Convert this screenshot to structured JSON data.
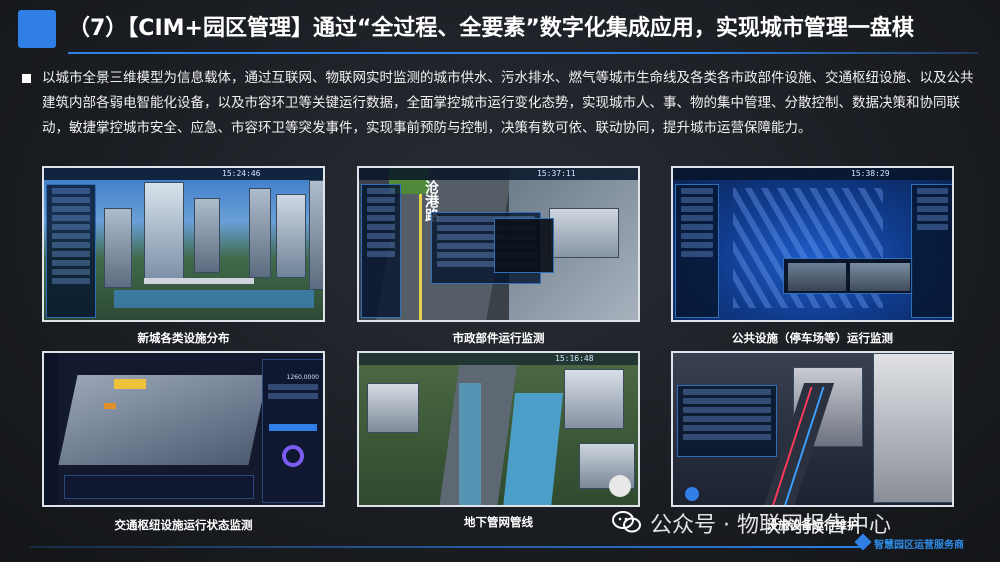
{
  "slide": {
    "title": "（7）【CIM+园区管理】通过“全过程、全要素”数字化集成应用，实现城市管理一盘棋",
    "paragraph": "以城市全景三维模型为信息载体，通过互联网、物联网实时监测的城市供水、污水排水、燃气等城市生命线及各类各市政部件设施、交通枢纽设施、以及公共建筑内部各弱电智能化设备，以及市容环卫等关键运行数据，全面掌控城市运行变化态势，实现城市人、事、物的集中管理、分散控制、数据决策和协同联动，敏捷掌控城市安全、应急、市容环卫等突发事件，实现事前预防与控制，决策有数可依、联动协同，提升城市运营保障能力。"
  },
  "screenshots": [
    {
      "caption": "新城各类设施分布",
      "time": "15:24:46"
    },
    {
      "caption": "市政部件运行监测",
      "time": "15:37:11",
      "road_text": "沧港路"
    },
    {
      "caption": "公共设施（停车场等）运行监测",
      "time": "15:38:29"
    },
    {
      "caption": "交通枢纽设施运行状态监测",
      "stat": "1260,0000"
    },
    {
      "caption": "地下管网管线",
      "time": "15:16:48"
    },
    {
      "caption": "设施设备运行维护"
    }
  ],
  "footer": {
    "watermark": "公众号 · 物联网报告中心",
    "brand": "智慧园区运营服务商"
  },
  "colors": {
    "accent": "#2f7fe6",
    "background": "#1a1d22"
  }
}
